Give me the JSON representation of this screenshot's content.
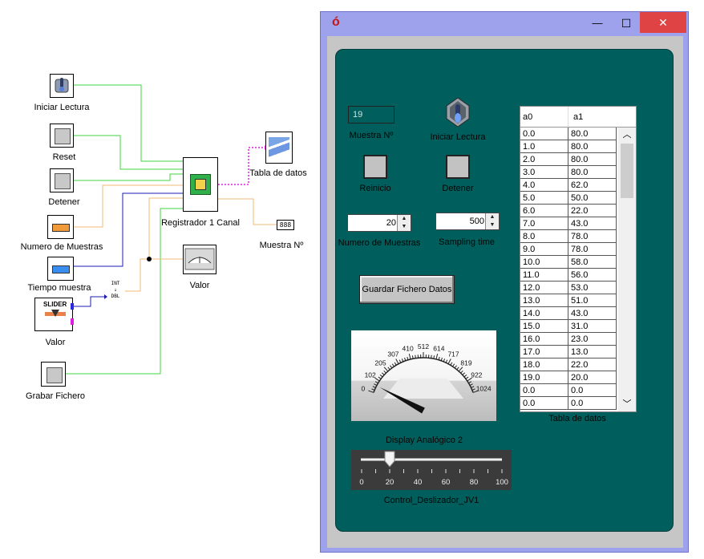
{
  "diagram": {
    "blocks": [
      {
        "label": "Iniciar Lectura"
      },
      {
        "label": "Reset"
      },
      {
        "label": "Detener"
      },
      {
        "label": "Numero de Muestras"
      },
      {
        "label": "Tiempo muestra"
      },
      {
        "label": "Valor"
      },
      {
        "label": "Grabar Fichero"
      },
      {
        "label": "Registrador 1 Canal"
      },
      {
        "label": "Tabla de datos"
      },
      {
        "label": "Muestra Nº"
      },
      {
        "label": "Valor"
      }
    ],
    "converter": {
      "top": "INT",
      "bottom": "DBL"
    },
    "slider_text": "SLIDER"
  },
  "window": {
    "app_glyph": "ó",
    "controls": {
      "minimize": "—",
      "maximize": "☐",
      "close": "✕"
    }
  },
  "panel": {
    "muestra": {
      "value": "19",
      "label": "Muestra Nº"
    },
    "iniciar": {
      "label": "Iniciar Lectura"
    },
    "reinicio": {
      "label": "Reinicio"
    },
    "detener": {
      "label": "Detener"
    },
    "num_muestras": {
      "value": "20",
      "label": "Numero de Muestras"
    },
    "sampling": {
      "value": "500",
      "label": "Sampling time"
    },
    "guardar": {
      "label": "Guardar Fichero Datos"
    },
    "gauge": {
      "label": "Display Analógico 2",
      "ticks": [
        "0",
        "102",
        "205",
        "307",
        "410",
        "512",
        "614",
        "717",
        "819",
        "922",
        "1024"
      ],
      "value": 60,
      "min": 0,
      "max": 1024
    },
    "slider": {
      "label": "Control_Deslizador_JV1",
      "ticks": [
        "0",
        "20",
        "40",
        "60",
        "80",
        "100"
      ],
      "value": 20
    },
    "table": {
      "label": "Tabla de datos",
      "headers": [
        "a0",
        "a1"
      ],
      "rows": [
        [
          "0.0",
          "80.0"
        ],
        [
          "1.0",
          "80.0"
        ],
        [
          "2.0",
          "80.0"
        ],
        [
          "3.0",
          "80.0"
        ],
        [
          "4.0",
          "62.0"
        ],
        [
          "5.0",
          "50.0"
        ],
        [
          "6.0",
          "22.0"
        ],
        [
          "7.0",
          "43.0"
        ],
        [
          "8.0",
          "78.0"
        ],
        [
          "9.0",
          "78.0"
        ],
        [
          "10.0",
          "58.0"
        ],
        [
          "11.0",
          "56.0"
        ],
        [
          "12.0",
          "53.0"
        ],
        [
          "13.0",
          "51.0"
        ],
        [
          "14.0",
          "43.0"
        ],
        [
          "15.0",
          "31.0"
        ],
        [
          "16.0",
          "23.0"
        ],
        [
          "17.0",
          "13.0"
        ],
        [
          "18.0",
          "22.0"
        ],
        [
          "19.0",
          "20.0"
        ],
        [
          "0.0",
          "0.0"
        ],
        [
          "0.0",
          "0.0"
        ]
      ]
    }
  },
  "colors": {
    "panel_bg": "#005e5c",
    "window_frame": "#9ea2ec",
    "close_button": "#e04343",
    "wire_green": "#3fd43f",
    "wire_blue": "#1b1bb4",
    "wire_orange": "#f0b878",
    "wire_magenta": "#e020e0"
  }
}
